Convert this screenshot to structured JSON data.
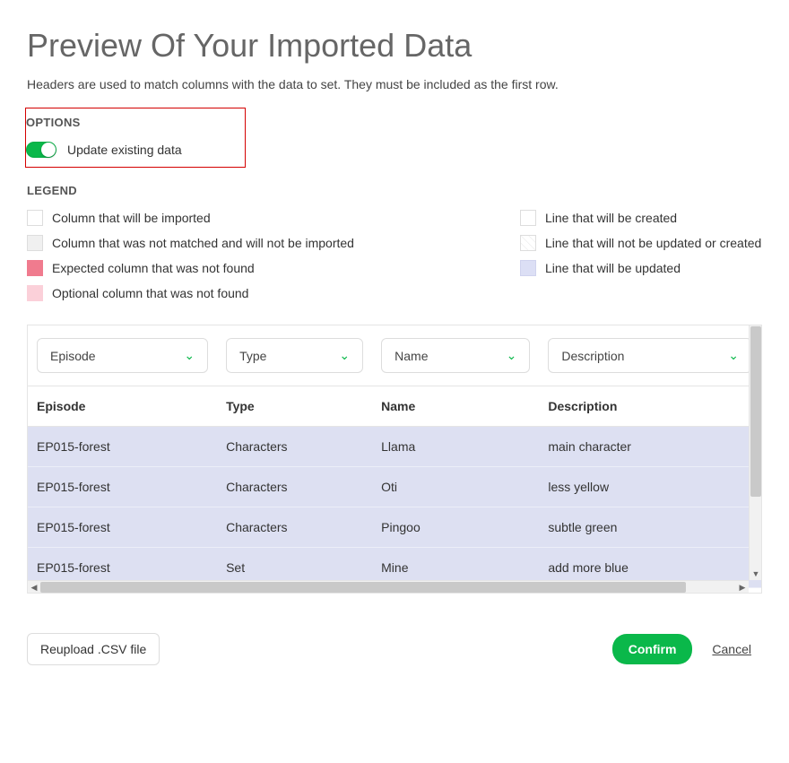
{
  "title": "Preview Of Your Imported Data",
  "subtitle": "Headers are used to match columns with the data to set. They must be included as the first row.",
  "options": {
    "section_label": "OPTIONS",
    "toggle_label": "Update existing data",
    "toggle_on": true
  },
  "legend": {
    "section_label": "LEGEND",
    "left": [
      "Column that will be imported",
      "Column that was not matched and will not be imported",
      "Expected column that was not found",
      "Optional column that was not found"
    ],
    "right": [
      "Line that will be created",
      "Line that will not be updated or created",
      "Line that will be updated"
    ]
  },
  "table": {
    "column_selects": [
      "Episode",
      "Type",
      "Name",
      "Description"
    ],
    "headers": [
      "Episode",
      "Type",
      "Name",
      "Description"
    ],
    "rows": [
      {
        "episode": "EP015-forest",
        "type": "Characters",
        "name": "Llama",
        "desc": "main character"
      },
      {
        "episode": "EP015-forest",
        "type": "Characters",
        "name": "Oti",
        "desc": "less yellow"
      },
      {
        "episode": "EP015-forest",
        "type": "Characters",
        "name": "Pingoo",
        "desc": "subtle green"
      },
      {
        "episode": "EP015-forest",
        "type": "Set",
        "name": "Mine",
        "desc": "add more blue"
      }
    ]
  },
  "actions": {
    "reupload": "Reupload .CSV file",
    "confirm": "Confirm",
    "cancel": "Cancel"
  }
}
